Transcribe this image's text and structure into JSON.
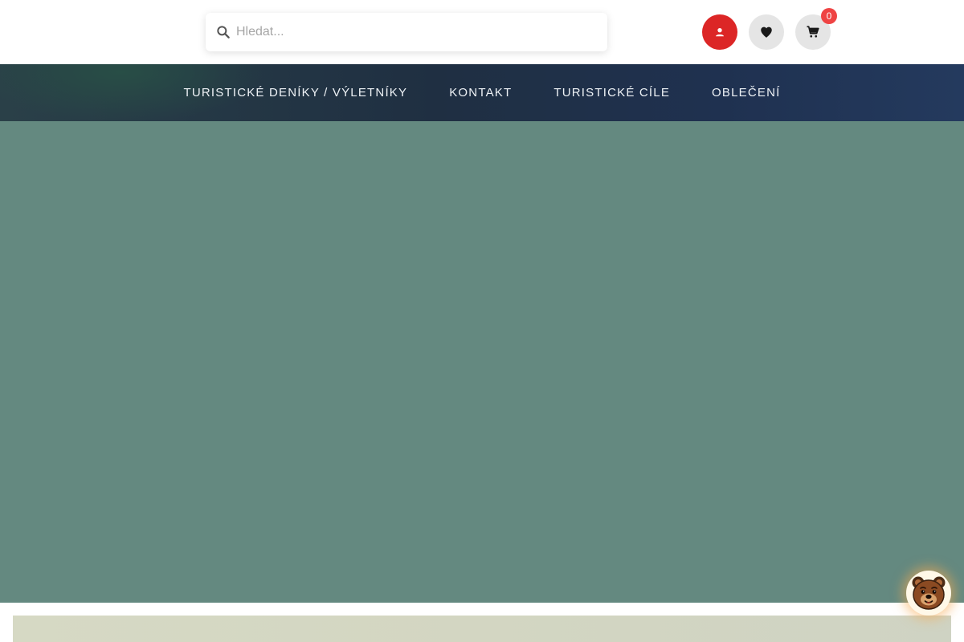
{
  "header": {
    "search": {
      "placeholder": "Hledat..."
    },
    "cart": {
      "count": "0"
    },
    "icons": {
      "search": "search-icon",
      "user": "user-icon",
      "wishlist": "heart-icon",
      "cart": "cart-icon"
    }
  },
  "nav": {
    "items": [
      {
        "label": "TURISTICKÉ DENÍKY / VÝLETNÍKY"
      },
      {
        "label": "KONTAKT"
      },
      {
        "label": "TURISTICKÉ CÍLE"
      },
      {
        "label": "OBLEČENÍ"
      }
    ]
  },
  "colors": {
    "accent": "#dc2626",
    "badge": "#ef4444",
    "hero": "#648980",
    "nav": "#1f2f42"
  },
  "widgets": {
    "chat": "bear-icon"
  }
}
